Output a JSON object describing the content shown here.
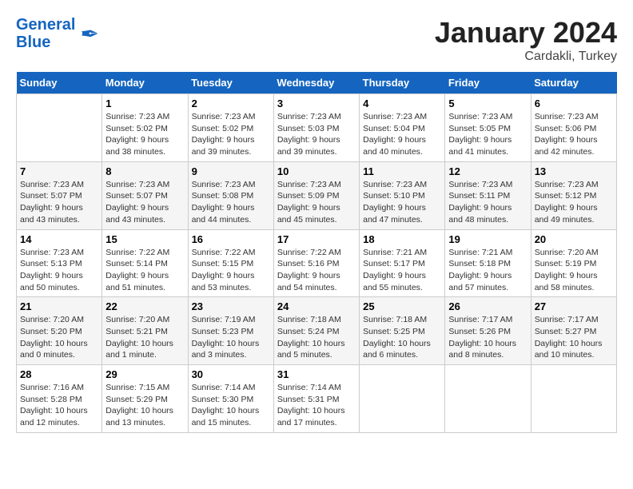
{
  "header": {
    "logo_line1": "General",
    "logo_line2": "Blue",
    "month": "January 2024",
    "location": "Cardakli, Turkey"
  },
  "days_of_week": [
    "Sunday",
    "Monday",
    "Tuesday",
    "Wednesday",
    "Thursday",
    "Friday",
    "Saturday"
  ],
  "weeks": [
    [
      {
        "num": "",
        "info": ""
      },
      {
        "num": "1",
        "info": "Sunrise: 7:23 AM\nSunset: 5:02 PM\nDaylight: 9 hours\nand 38 minutes."
      },
      {
        "num": "2",
        "info": "Sunrise: 7:23 AM\nSunset: 5:02 PM\nDaylight: 9 hours\nand 39 minutes."
      },
      {
        "num": "3",
        "info": "Sunrise: 7:23 AM\nSunset: 5:03 PM\nDaylight: 9 hours\nand 39 minutes."
      },
      {
        "num": "4",
        "info": "Sunrise: 7:23 AM\nSunset: 5:04 PM\nDaylight: 9 hours\nand 40 minutes."
      },
      {
        "num": "5",
        "info": "Sunrise: 7:23 AM\nSunset: 5:05 PM\nDaylight: 9 hours\nand 41 minutes."
      },
      {
        "num": "6",
        "info": "Sunrise: 7:23 AM\nSunset: 5:06 PM\nDaylight: 9 hours\nand 42 minutes."
      }
    ],
    [
      {
        "num": "7",
        "info": "Sunrise: 7:23 AM\nSunset: 5:07 PM\nDaylight: 9 hours\nand 43 minutes."
      },
      {
        "num": "8",
        "info": "Sunrise: 7:23 AM\nSunset: 5:07 PM\nDaylight: 9 hours\nand 43 minutes."
      },
      {
        "num": "9",
        "info": "Sunrise: 7:23 AM\nSunset: 5:08 PM\nDaylight: 9 hours\nand 44 minutes."
      },
      {
        "num": "10",
        "info": "Sunrise: 7:23 AM\nSunset: 5:09 PM\nDaylight: 9 hours\nand 45 minutes."
      },
      {
        "num": "11",
        "info": "Sunrise: 7:23 AM\nSunset: 5:10 PM\nDaylight: 9 hours\nand 47 minutes."
      },
      {
        "num": "12",
        "info": "Sunrise: 7:23 AM\nSunset: 5:11 PM\nDaylight: 9 hours\nand 48 minutes."
      },
      {
        "num": "13",
        "info": "Sunrise: 7:23 AM\nSunset: 5:12 PM\nDaylight: 9 hours\nand 49 minutes."
      }
    ],
    [
      {
        "num": "14",
        "info": "Sunrise: 7:23 AM\nSunset: 5:13 PM\nDaylight: 9 hours\nand 50 minutes."
      },
      {
        "num": "15",
        "info": "Sunrise: 7:22 AM\nSunset: 5:14 PM\nDaylight: 9 hours\nand 51 minutes."
      },
      {
        "num": "16",
        "info": "Sunrise: 7:22 AM\nSunset: 5:15 PM\nDaylight: 9 hours\nand 53 minutes."
      },
      {
        "num": "17",
        "info": "Sunrise: 7:22 AM\nSunset: 5:16 PM\nDaylight: 9 hours\nand 54 minutes."
      },
      {
        "num": "18",
        "info": "Sunrise: 7:21 AM\nSunset: 5:17 PM\nDaylight: 9 hours\nand 55 minutes."
      },
      {
        "num": "19",
        "info": "Sunrise: 7:21 AM\nSunset: 5:18 PM\nDaylight: 9 hours\nand 57 minutes."
      },
      {
        "num": "20",
        "info": "Sunrise: 7:20 AM\nSunset: 5:19 PM\nDaylight: 9 hours\nand 58 minutes."
      }
    ],
    [
      {
        "num": "21",
        "info": "Sunrise: 7:20 AM\nSunset: 5:20 PM\nDaylight: 10 hours\nand 0 minutes."
      },
      {
        "num": "22",
        "info": "Sunrise: 7:20 AM\nSunset: 5:21 PM\nDaylight: 10 hours\nand 1 minute."
      },
      {
        "num": "23",
        "info": "Sunrise: 7:19 AM\nSunset: 5:23 PM\nDaylight: 10 hours\nand 3 minutes."
      },
      {
        "num": "24",
        "info": "Sunrise: 7:18 AM\nSunset: 5:24 PM\nDaylight: 10 hours\nand 5 minutes."
      },
      {
        "num": "25",
        "info": "Sunrise: 7:18 AM\nSunset: 5:25 PM\nDaylight: 10 hours\nand 6 minutes."
      },
      {
        "num": "26",
        "info": "Sunrise: 7:17 AM\nSunset: 5:26 PM\nDaylight: 10 hours\nand 8 minutes."
      },
      {
        "num": "27",
        "info": "Sunrise: 7:17 AM\nSunset: 5:27 PM\nDaylight: 10 hours\nand 10 minutes."
      }
    ],
    [
      {
        "num": "28",
        "info": "Sunrise: 7:16 AM\nSunset: 5:28 PM\nDaylight: 10 hours\nand 12 minutes."
      },
      {
        "num": "29",
        "info": "Sunrise: 7:15 AM\nSunset: 5:29 PM\nDaylight: 10 hours\nand 13 minutes."
      },
      {
        "num": "30",
        "info": "Sunrise: 7:14 AM\nSunset: 5:30 PM\nDaylight: 10 hours\nand 15 minutes."
      },
      {
        "num": "31",
        "info": "Sunrise: 7:14 AM\nSunset: 5:31 PM\nDaylight: 10 hours\nand 17 minutes."
      },
      {
        "num": "",
        "info": ""
      },
      {
        "num": "",
        "info": ""
      },
      {
        "num": "",
        "info": ""
      }
    ]
  ]
}
